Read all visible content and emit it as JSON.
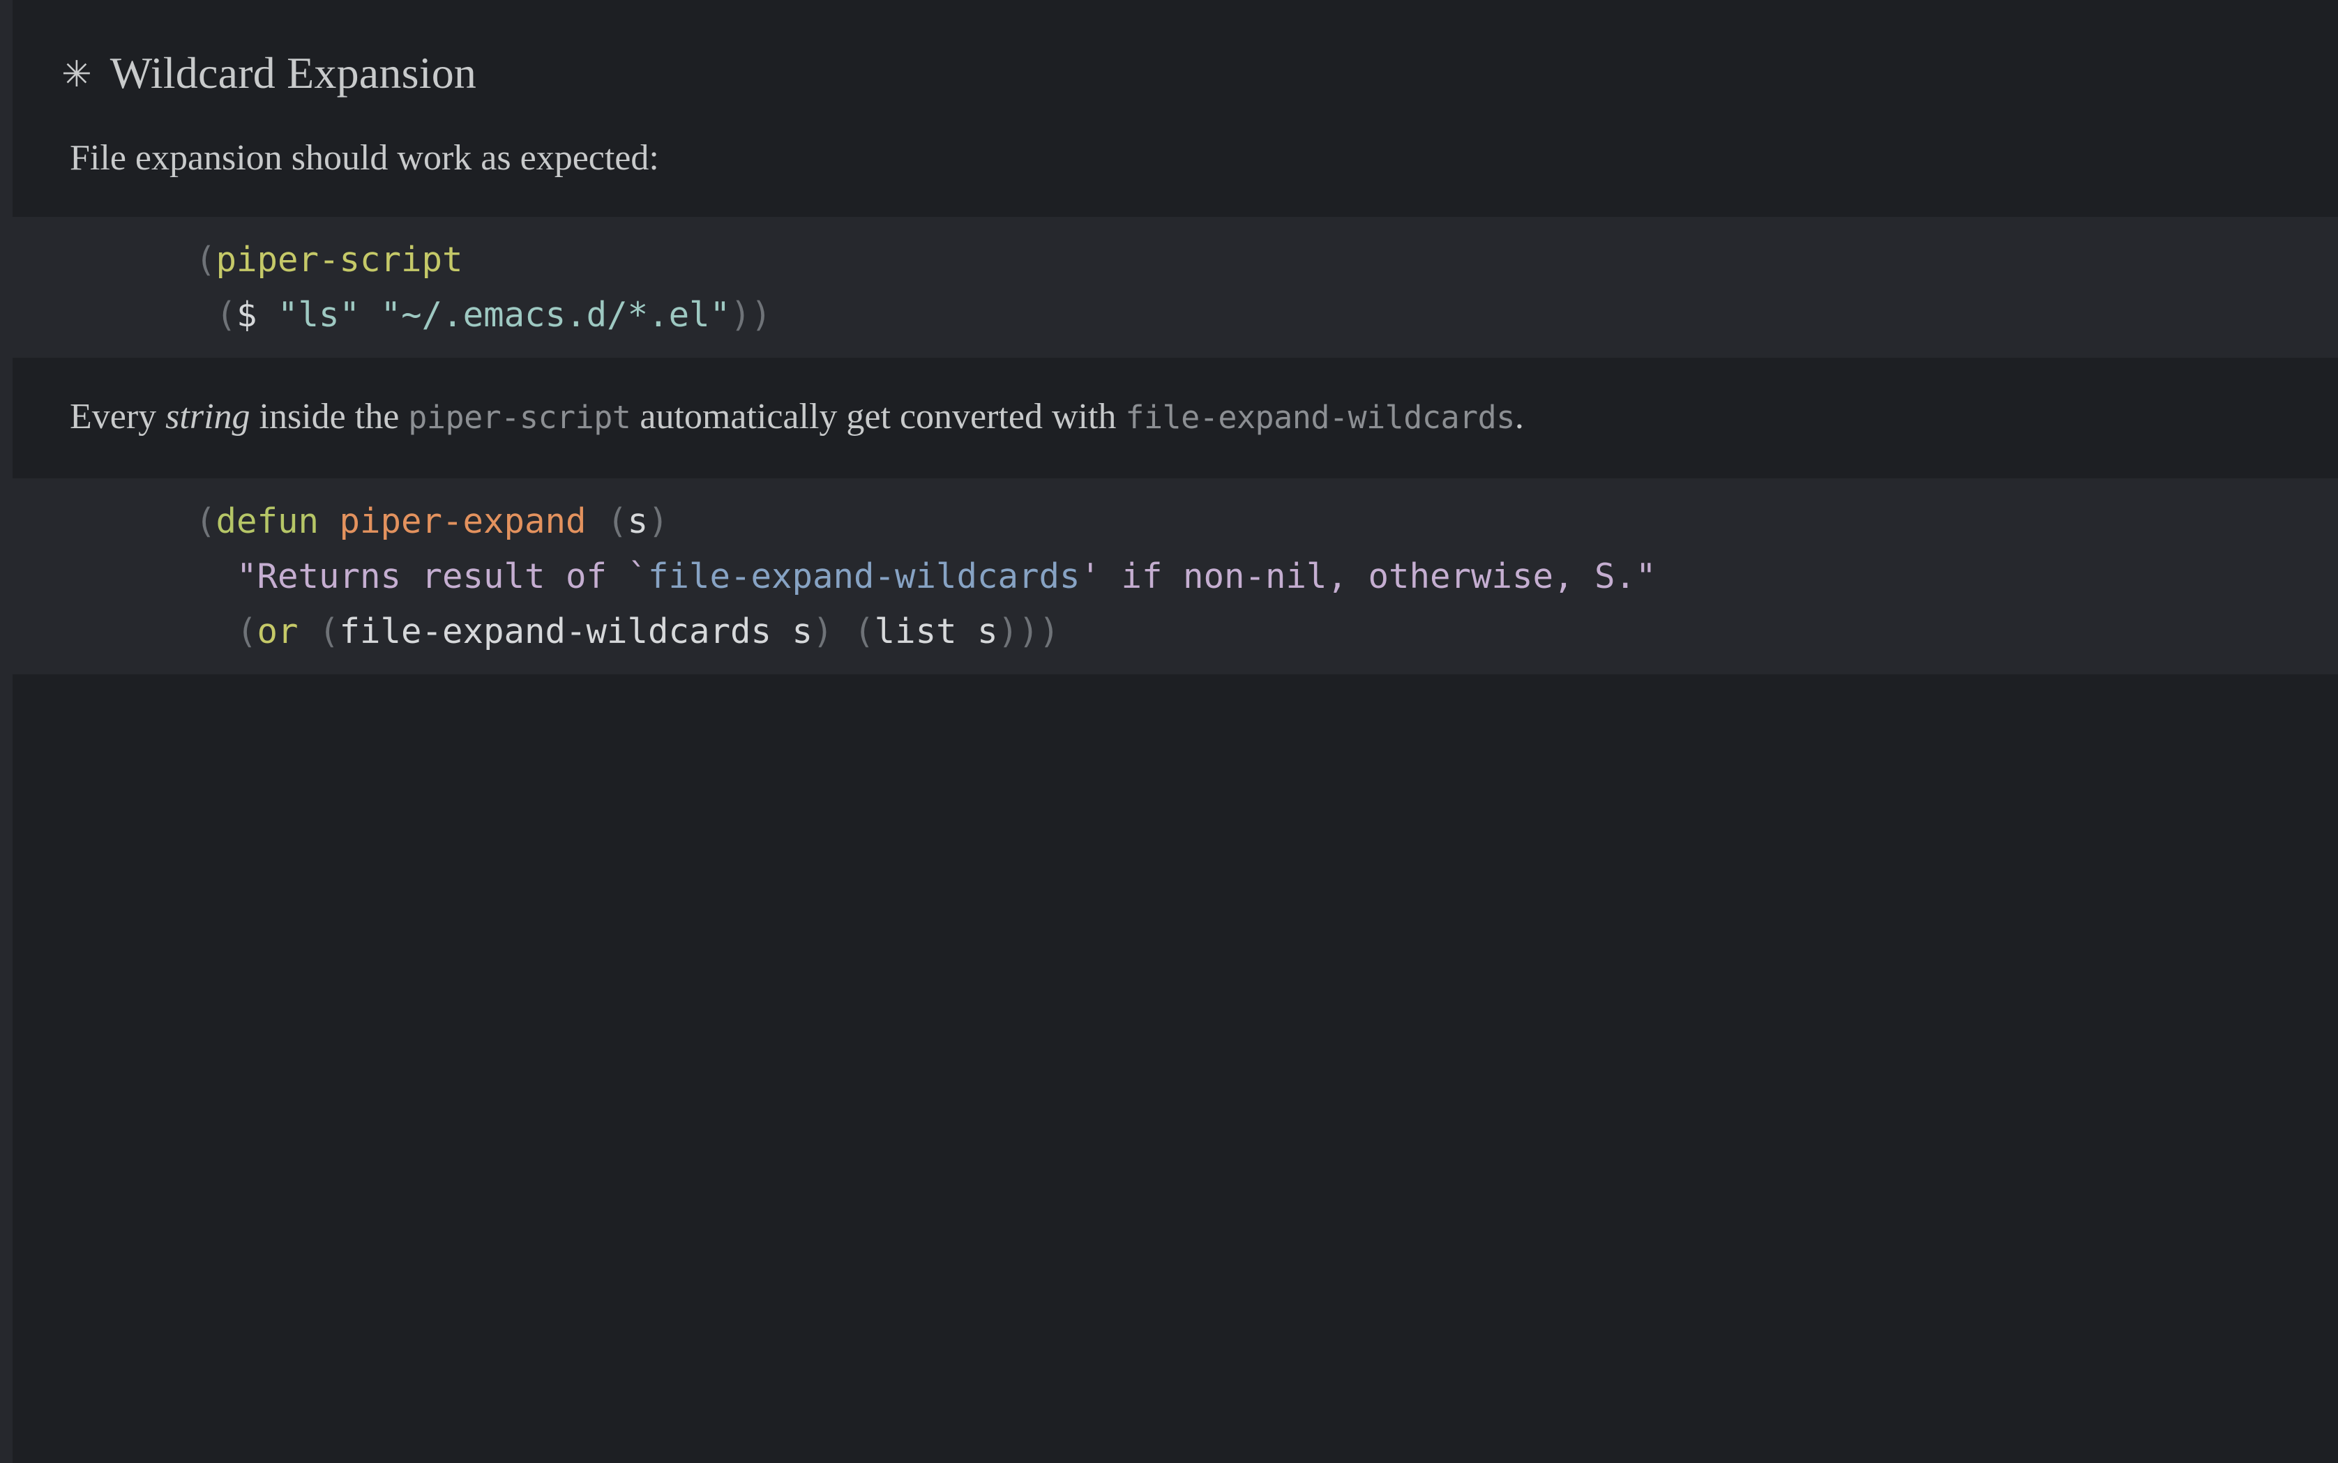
{
  "document": {
    "heading": {
      "bullet_icon": "eight-pointed-star-icon",
      "bullet_glyph": "✳",
      "text": "Wildcard Expansion"
    },
    "paragraph_1": {
      "text": "File expansion should work as expected:"
    },
    "code_block_1": {
      "language": "emacs-lisp",
      "lines": [
        {
          "tokens": [
            {
              "text": "(",
              "kind": "paren"
            },
            {
              "text": "piper-script",
              "kind": "keyword"
            }
          ]
        },
        {
          "tokens": [
            {
              "text": " (",
              "kind": "paren"
            },
            {
              "text": "$",
              "kind": "plain"
            },
            {
              "text": " ",
              "kind": "plain"
            },
            {
              "text": "\"ls\"",
              "kind": "string"
            },
            {
              "text": " ",
              "kind": "plain"
            },
            {
              "text": "\"~/.emacs.d/*.el\"",
              "kind": "string"
            },
            {
              "text": "))",
              "kind": "paren"
            }
          ]
        }
      ],
      "plain_text": "(piper-script\n ($ \"ls\" \"~/.emacs.d/*.el\"))"
    },
    "paragraph_2": {
      "segments": [
        {
          "text": "Every ",
          "kind": "normal"
        },
        {
          "text": "string",
          "kind": "italic"
        },
        {
          "text": " inside the ",
          "kind": "normal"
        },
        {
          "text": "piper-script",
          "kind": "code"
        },
        {
          "text": " automatically get converted with ",
          "kind": "normal"
        },
        {
          "text": "file-expand-wildcards",
          "kind": "code"
        },
        {
          "text": ".",
          "kind": "normal"
        }
      ],
      "plain_text": "Every string inside the piper-script automatically get converted with file-expand-wildcards."
    },
    "code_block_2": {
      "language": "emacs-lisp",
      "lines": [
        {
          "tokens": [
            {
              "text": "(",
              "kind": "paren"
            },
            {
              "text": "defun",
              "kind": "keyword2"
            },
            {
              "text": " ",
              "kind": "plain"
            },
            {
              "text": "piper-expand",
              "kind": "function-name"
            },
            {
              "text": " (",
              "kind": "paren"
            },
            {
              "text": "s",
              "kind": "plain"
            },
            {
              "text": ")",
              "kind": "paren"
            }
          ]
        },
        {
          "tokens": [
            {
              "text": "  \"Returns result of `",
              "kind": "doc"
            },
            {
              "text": "file-expand-wildcards",
              "kind": "doc-ref"
            },
            {
              "text": "' if non-nil, otherwise, S.\"",
              "kind": "doc"
            }
          ]
        },
        {
          "tokens": [
            {
              "text": "  (",
              "kind": "paren"
            },
            {
              "text": "or",
              "kind": "keyword"
            },
            {
              "text": " (",
              "kind": "paren"
            },
            {
              "text": "file-expand-wildcards s",
              "kind": "plain"
            },
            {
              "text": ") (",
              "kind": "paren"
            },
            {
              "text": "list s",
              "kind": "plain"
            },
            {
              "text": ")))",
              "kind": "paren"
            }
          ]
        }
      ],
      "plain_text": "(defun piper-expand (s)\n  \"Returns result of `file-expand-wildcards' if non-nil, otherwise, S.\"\n  (or (file-expand-wildcards s) (list s)))"
    }
  },
  "colors": {
    "background": "#1d1f23",
    "code_background": "#26282d",
    "text": "#c8cacb",
    "inline_code": "#8c8f93",
    "paren": "#6f7378",
    "keyword": "#c5c968",
    "keyword2": "#b6c667",
    "function_name": "#e3925e",
    "string": "#9ec9c2",
    "docstring": "#c5aed1",
    "doc_reference": "#87a3c4"
  }
}
